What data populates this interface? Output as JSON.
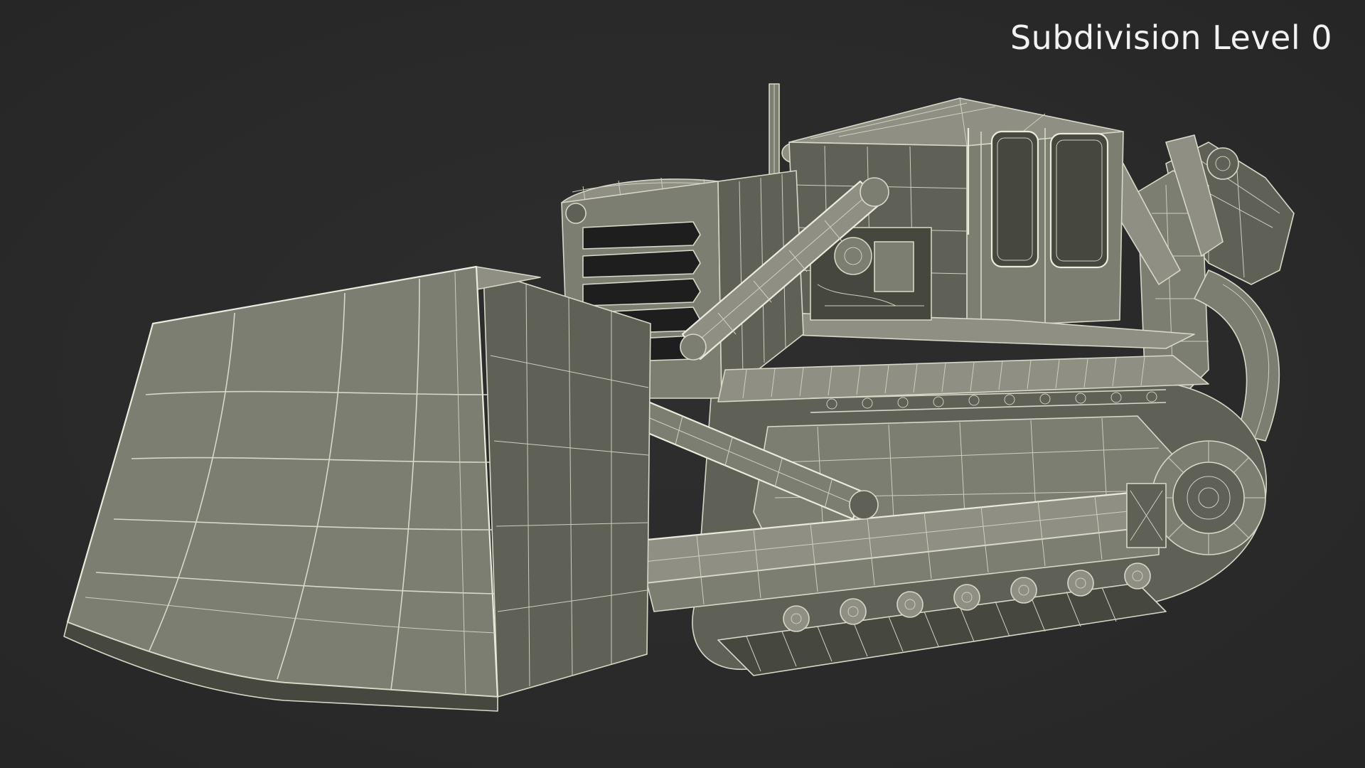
{
  "viewport": {
    "overlay_label": "Subdivision Level 0",
    "background_color": "#2b2b2b",
    "model_color": "#7d7e72",
    "wireframe_color": "#d8d8c6"
  },
  "model": {
    "subject": "bulldozer",
    "render_mode": "wireframe-on-shaded"
  }
}
